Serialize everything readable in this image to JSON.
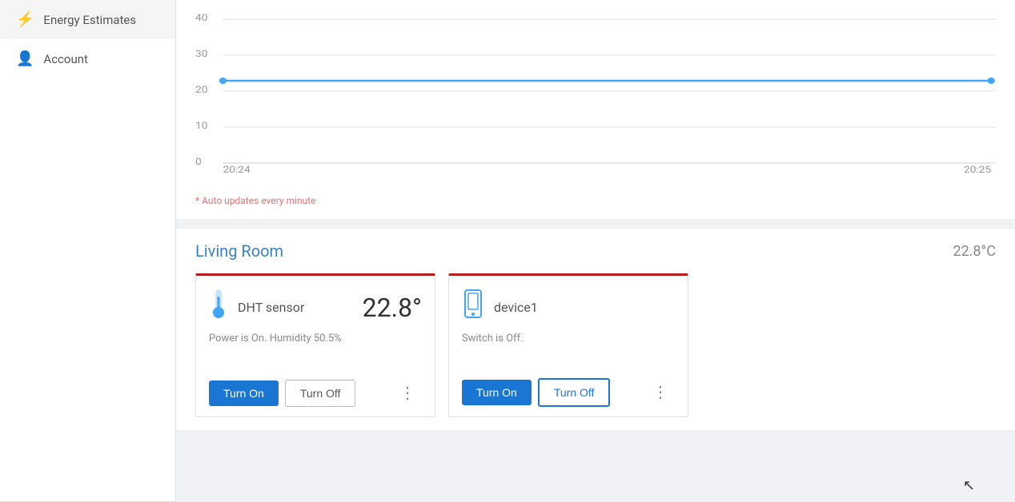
{
  "sidebar": {
    "items": [
      {
        "id": "energy-estimates",
        "label": "Energy Estimates",
        "icon": "⚡"
      },
      {
        "id": "account",
        "label": "Account",
        "icon": "👤"
      }
    ]
  },
  "chart": {
    "y_labels": [
      "40",
      "30",
      "20",
      "10",
      "0"
    ],
    "x_labels": [
      "20:24",
      "20:25"
    ],
    "data_y": 22.8,
    "line_color": "#42a5f5",
    "auto_update_note": "* Auto updates every minute"
  },
  "living_room": {
    "title": "Living Room",
    "temperature": "22.8°C",
    "devices": [
      {
        "id": "dht-sensor",
        "icon_type": "thermometer",
        "name": "DHT sensor",
        "value": "22.8°",
        "status": "Power is On. Humidity 50.5%",
        "btn_on_label": "Turn On",
        "btn_off_label": "Turn Off",
        "active_btn": "on"
      },
      {
        "id": "device1",
        "icon_type": "device",
        "name": "device1",
        "value": "",
        "status": "Switch is Off.",
        "btn_on_label": "Turn On",
        "btn_off_label": "Turn Off",
        "active_btn": "off"
      }
    ]
  },
  "cursor": "↖"
}
